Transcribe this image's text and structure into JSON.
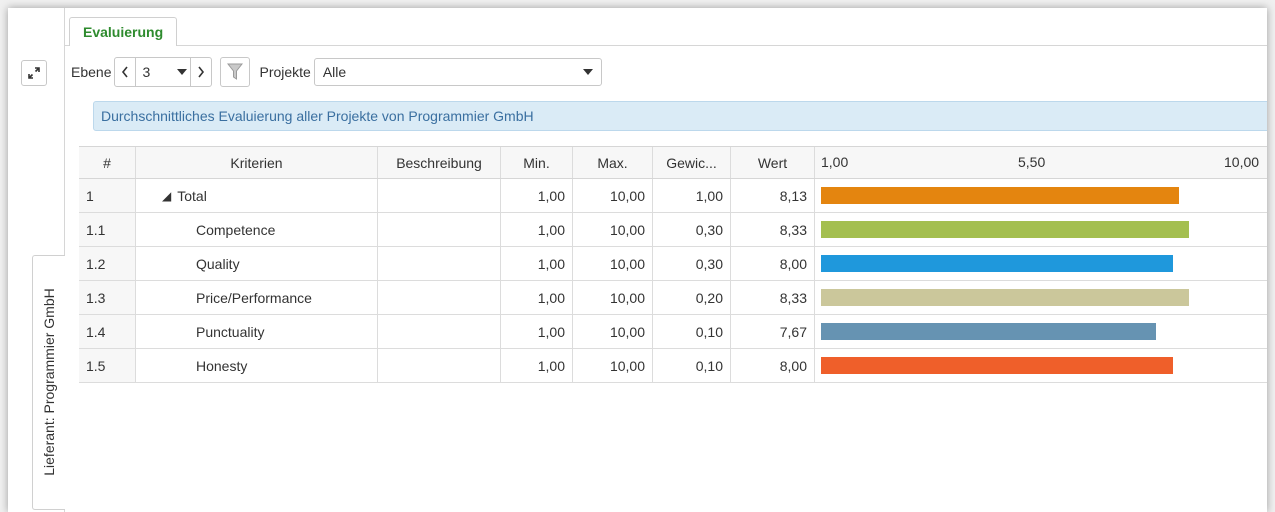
{
  "tab": {
    "label": "Evaluierung"
  },
  "side_tab": {
    "label": "Lieferant: Programmier GmbH"
  },
  "toolbar": {
    "ebene_label": "Ebene",
    "ebene_value": "3",
    "projekte_label": "Projekte",
    "projekte_value": "Alle"
  },
  "info_text": "Durchschnittliches Evaluierung aller Projekte von Programmier GmbH",
  "grid": {
    "headers": {
      "num": "#",
      "kriterien": "Kriterien",
      "beschreibung": "Beschreibung",
      "min": "Min.",
      "max": "Max.",
      "gewicht": "Gewic...",
      "wert": "Wert"
    },
    "scale": {
      "min_label": "1,00",
      "mid_label": "5,50",
      "max_label": "10,00",
      "min": 1,
      "max": 10
    },
    "rows": [
      {
        "num": "1",
        "kriterien": "Total",
        "beschreibung": "",
        "min": "1,00",
        "max": "10,00",
        "gewicht": "1,00",
        "wert": "8,13",
        "value": 8.13,
        "color": "#e4850f",
        "level": 0
      },
      {
        "num": "1.1",
        "kriterien": "Competence",
        "beschreibung": "",
        "min": "1,00",
        "max": "10,00",
        "gewicht": "0,30",
        "wert": "8,33",
        "value": 8.33,
        "color": "#a4bf50",
        "level": 1
      },
      {
        "num": "1.2",
        "kriterien": "Quality",
        "beschreibung": "",
        "min": "1,00",
        "max": "10,00",
        "gewicht": "0,30",
        "wert": "8,00",
        "value": 8.0,
        "color": "#1f98dc",
        "level": 1
      },
      {
        "num": "1.3",
        "kriterien": "Price/Performance",
        "beschreibung": "",
        "min": "1,00",
        "max": "10,00",
        "gewicht": "0,20",
        "wert": "8,33",
        "value": 8.33,
        "color": "#cbc79b",
        "level": 1
      },
      {
        "num": "1.4",
        "kriterien": "Punctuality",
        "beschreibung": "",
        "min": "1,00",
        "max": "10,00",
        "gewicht": "0,10",
        "wert": "7,67",
        "value": 7.67,
        "color": "#6693b2",
        "level": 1
      },
      {
        "num": "1.5",
        "kriterien": "Honesty",
        "beschreibung": "",
        "min": "1,00",
        "max": "10,00",
        "gewicht": "0,10",
        "wert": "8,00",
        "value": 8.0,
        "color": "#ef5f2a",
        "level": 1
      }
    ]
  }
}
